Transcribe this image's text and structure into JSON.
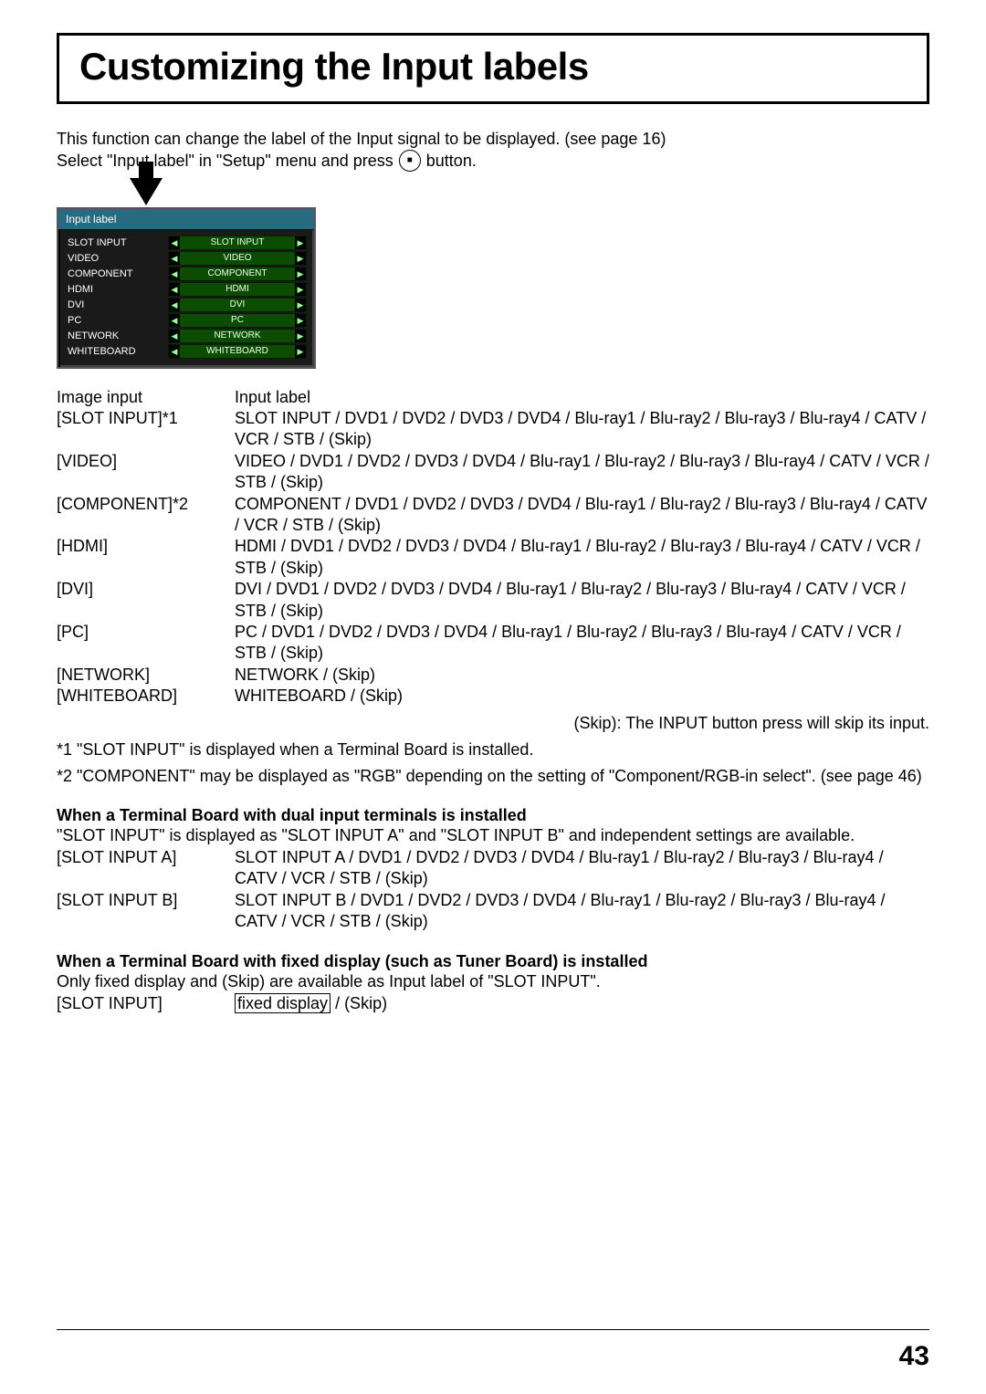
{
  "pageNumber": "43",
  "title": "Customizing the Input labels",
  "intro": {
    "line1": "This function can change the label of the Input signal to be displayed. (see page 16)",
    "line2a": "Select \"Input label\" in \"Setup\" menu and press",
    "line2b": "button."
  },
  "osd": {
    "title": "Input label",
    "rows": [
      {
        "name": "SLOT INPUT",
        "value": "SLOT INPUT"
      },
      {
        "name": "VIDEO",
        "value": "VIDEO"
      },
      {
        "name": "COMPONENT",
        "value": "COMPONENT"
      },
      {
        "name": "HDMI",
        "value": "HDMI"
      },
      {
        "name": "DVI",
        "value": "DVI"
      },
      {
        "name": "PC",
        "value": "PC"
      },
      {
        "name": "NETWORK",
        "value": "NETWORK"
      },
      {
        "name": "WHITEBOARD",
        "value": "WHITEBOARD"
      }
    ]
  },
  "defHead": {
    "k": "Image input",
    "v": "Input label"
  },
  "defs": [
    {
      "k": "[SLOT INPUT]*1",
      "v": "SLOT INPUT / DVD1 / DVD2 / DVD3 / DVD4 / Blu-ray1 / Blu-ray2 / Blu-ray3 / Blu-ray4 / CATV / VCR / STB / (Skip)"
    },
    {
      "k": "[VIDEO]",
      "v": "VIDEO / DVD1 / DVD2 / DVD3 / DVD4 / Blu-ray1 / Blu-ray2 / Blu-ray3 / Blu-ray4 / CATV / VCR / STB / (Skip)"
    },
    {
      "k": "[COMPONENT]*2",
      "v": "COMPONENT / DVD1 / DVD2 / DVD3 / DVD4 / Blu-ray1 / Blu-ray2 / Blu-ray3 / Blu-ray4 / CATV / VCR / STB / (Skip)"
    },
    {
      "k": "[HDMI]",
      "v": "HDMI / DVD1 / DVD2 / DVD3 / DVD4 / Blu-ray1 / Blu-ray2 / Blu-ray3 / Blu-ray4 / CATV / VCR / STB / (Skip)"
    },
    {
      "k": "[DVI]",
      "v": "DVI / DVD1 / DVD2 / DVD3 / DVD4 / Blu-ray1 / Blu-ray2 / Blu-ray3 / Blu-ray4 / CATV / VCR / STB / (Skip)"
    },
    {
      "k": "[PC]",
      "v": "PC / DVD1 / DVD2 / DVD3 / DVD4 / Blu-ray1 / Blu-ray2 / Blu-ray3 / Blu-ray4 / CATV / VCR / STB / (Skip)"
    },
    {
      "k": "[NETWORK]",
      "v": "NETWORK / (Skip)"
    },
    {
      "k": "[WHITEBOARD]",
      "v": "WHITEBOARD / (Skip)"
    }
  ],
  "skipNote": "(Skip): The INPUT button press will skip its input.",
  "footnote1": "*1 \"SLOT INPUT\" is displayed when a Terminal Board is installed.",
  "footnote2": "*2 \"COMPONENT\" may be displayed as \"RGB\" depending on the setting of \"Component/RGB-in select\". (see page 46)",
  "dual": {
    "heading": "When a Terminal Board with dual input terminals is installed",
    "intro": "\"SLOT INPUT\" is displayed as \"SLOT INPUT A\" and \"SLOT INPUT B\" and independent settings are available.",
    "rows": [
      {
        "k": "[SLOT INPUT A]",
        "v": "SLOT INPUT A / DVD1 / DVD2 / DVD3 / DVD4 / Blu-ray1 / Blu-ray2 / Blu-ray3 / Blu-ray4 / CATV / VCR / STB / (Skip)"
      },
      {
        "k": "[SLOT INPUT B]",
        "v": "SLOT INPUT B / DVD1 / DVD2 / DVD3 / DVD4 / Blu-ray1 / Blu-ray2 / Blu-ray3 / Blu-ray4 / CATV / VCR / STB / (Skip)"
      }
    ]
  },
  "fixed": {
    "heading": "When a Terminal Board with fixed display (such as Tuner Board) is installed",
    "intro": "Only fixed display and (Skip) are available as Input label of \"SLOT INPUT\".",
    "k": "[SLOT INPUT]",
    "boxed": "fixed display",
    "after": " / (Skip)"
  }
}
